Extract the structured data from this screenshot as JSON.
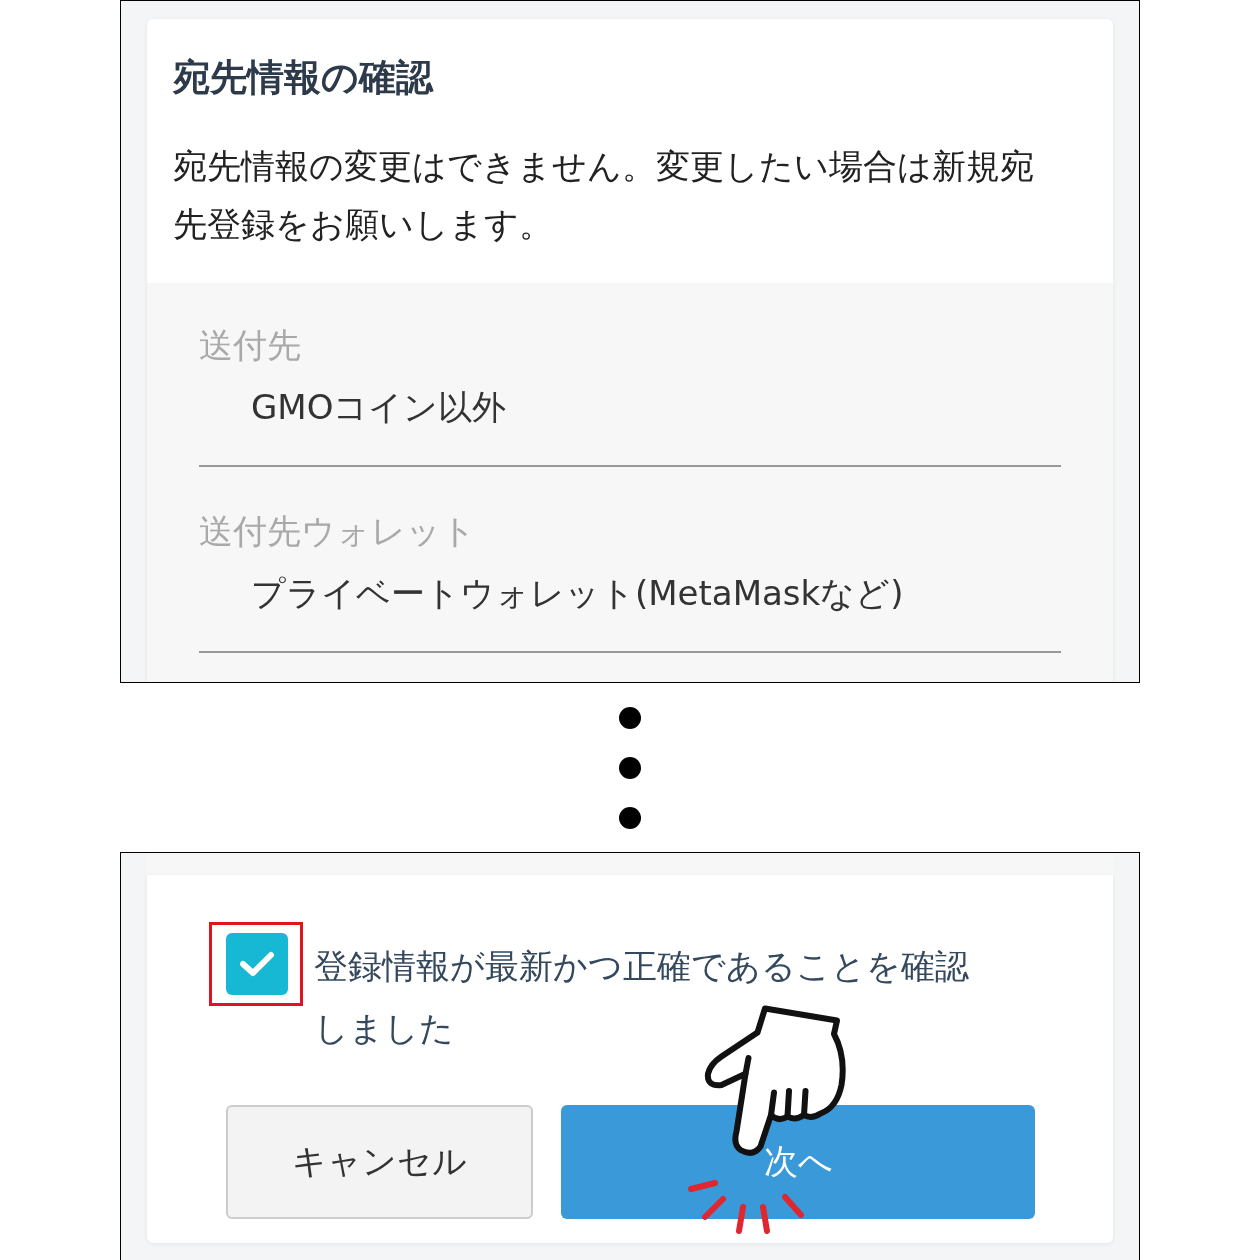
{
  "top_screen": {
    "title": "宛先情報の確認",
    "notice": "宛先情報の変更はできません。変更したい場合は新規宛先登録をお願いします。",
    "fields": [
      {
        "label": "送付先",
        "value": "GMOコイン以外"
      },
      {
        "label": "送付先ウォレット",
        "value": "プライベートウォレット(MetaMaskなど)"
      }
    ]
  },
  "bottom_screen": {
    "confirm": {
      "checked": true,
      "label": "登録情報が最新かつ正確であることを確認しました"
    },
    "buttons": [
      {
        "kind": "secondary",
        "label": "キャンセル"
      },
      {
        "kind": "primary",
        "label": "次へ"
      }
    ]
  }
}
